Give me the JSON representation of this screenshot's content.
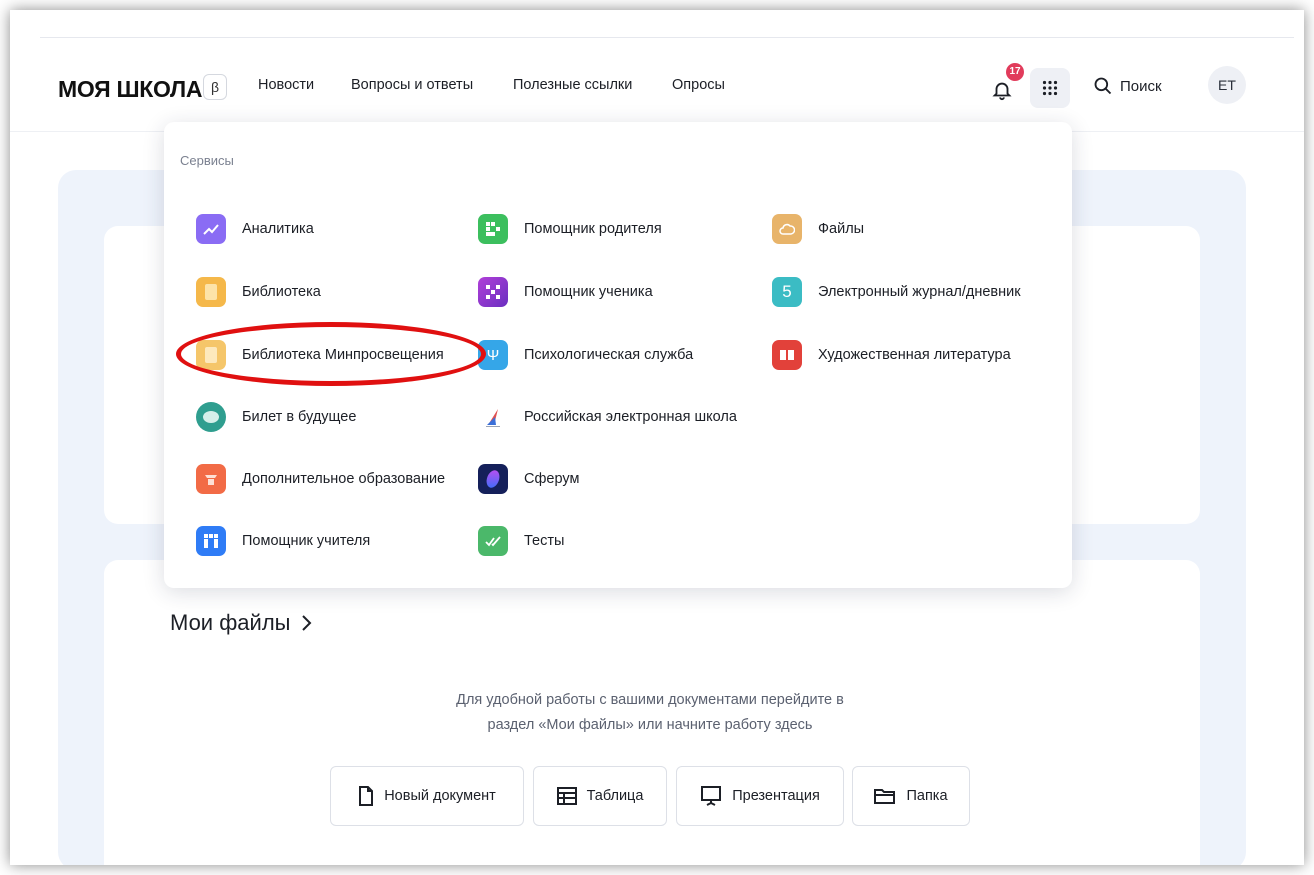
{
  "header": {
    "logo": "МОЯ ШКОЛА",
    "beta": "β",
    "nav": [
      "Новости",
      "Вопросы и ответы",
      "Полезные ссылки",
      "Опросы"
    ],
    "notifications_count": "17",
    "search_label": "Поиск",
    "avatar": "ЕТ"
  },
  "services": {
    "title": "Сервисы",
    "columns": [
      [
        {
          "label": "Аналитика",
          "icon": "analytics-icon",
          "color": "#8a6cf4"
        },
        {
          "label": "Библиотека",
          "icon": "book-icon",
          "color": "#f5b84a"
        },
        {
          "label": "Библиотека Минпросвещения",
          "icon": "book-icon",
          "color": "#f5c66a"
        },
        {
          "label": "Билет в будущее",
          "icon": "ticket-icon",
          "color": "#2f9e8f"
        },
        {
          "label": "Дополнительное образование",
          "icon": "education-icon",
          "color": "#f26b46"
        },
        {
          "label": "Помощник учителя",
          "icon": "teacher-icon",
          "color": "#2f7cf6"
        }
      ],
      [
        {
          "label": "Помощник родителя",
          "icon": "parent-icon",
          "color": "#3cbf5e"
        },
        {
          "label": "Помощник ученика",
          "icon": "student-icon",
          "color": "#9b3fd1"
        },
        {
          "label": "Психологическая служба",
          "icon": "psychology-icon",
          "color": "#35a6e8"
        },
        {
          "label": "Российская электронная школа",
          "icon": "res-icon",
          "color": "#e05050"
        },
        {
          "label": "Сферум",
          "icon": "sferum-icon",
          "color": "#15205a"
        },
        {
          "label": "Тесты",
          "icon": "tests-icon",
          "color": "#4bb86a"
        }
      ],
      [
        {
          "label": "Файлы",
          "icon": "cloud-icon",
          "color": "#e8b46a"
        },
        {
          "label": "Электронный журнал/дневник",
          "icon": "journal-icon",
          "color": "#3bbcc4",
          "glyph": "5"
        },
        {
          "label": "Художественная литература",
          "icon": "open-book-icon",
          "color": "#e2413a"
        }
      ]
    ]
  },
  "files": {
    "title": "Мои файлы",
    "desc_line1": "Для удобной работы с вашими документами перейдите в",
    "desc_line2": "раздел «Мои файлы» или начните работу здесь",
    "buttons": [
      "Новый документ",
      "Таблица",
      "Презентация",
      "Папка"
    ]
  }
}
